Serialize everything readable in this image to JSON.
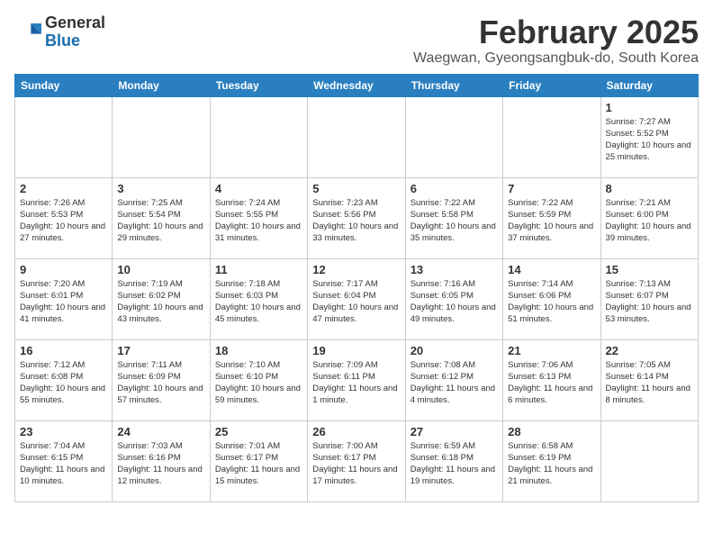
{
  "header": {
    "logo_general": "General",
    "logo_blue": "Blue",
    "month_year": "February 2025",
    "location": "Waegwan, Gyeongsangbuk-do, South Korea"
  },
  "weekdays": [
    "Sunday",
    "Monday",
    "Tuesday",
    "Wednesday",
    "Thursday",
    "Friday",
    "Saturday"
  ],
  "weeks": [
    [
      {
        "day": "",
        "info": ""
      },
      {
        "day": "",
        "info": ""
      },
      {
        "day": "",
        "info": ""
      },
      {
        "day": "",
        "info": ""
      },
      {
        "day": "",
        "info": ""
      },
      {
        "day": "",
        "info": ""
      },
      {
        "day": "1",
        "info": "Sunrise: 7:27 AM\nSunset: 5:52 PM\nDaylight: 10 hours and 25 minutes."
      }
    ],
    [
      {
        "day": "2",
        "info": "Sunrise: 7:26 AM\nSunset: 5:53 PM\nDaylight: 10 hours and 27 minutes."
      },
      {
        "day": "3",
        "info": "Sunrise: 7:25 AM\nSunset: 5:54 PM\nDaylight: 10 hours and 29 minutes."
      },
      {
        "day": "4",
        "info": "Sunrise: 7:24 AM\nSunset: 5:55 PM\nDaylight: 10 hours and 31 minutes."
      },
      {
        "day": "5",
        "info": "Sunrise: 7:23 AM\nSunset: 5:56 PM\nDaylight: 10 hours and 33 minutes."
      },
      {
        "day": "6",
        "info": "Sunrise: 7:22 AM\nSunset: 5:58 PM\nDaylight: 10 hours and 35 minutes."
      },
      {
        "day": "7",
        "info": "Sunrise: 7:22 AM\nSunset: 5:59 PM\nDaylight: 10 hours and 37 minutes."
      },
      {
        "day": "8",
        "info": "Sunrise: 7:21 AM\nSunset: 6:00 PM\nDaylight: 10 hours and 39 minutes."
      }
    ],
    [
      {
        "day": "9",
        "info": "Sunrise: 7:20 AM\nSunset: 6:01 PM\nDaylight: 10 hours and 41 minutes."
      },
      {
        "day": "10",
        "info": "Sunrise: 7:19 AM\nSunset: 6:02 PM\nDaylight: 10 hours and 43 minutes."
      },
      {
        "day": "11",
        "info": "Sunrise: 7:18 AM\nSunset: 6:03 PM\nDaylight: 10 hours and 45 minutes."
      },
      {
        "day": "12",
        "info": "Sunrise: 7:17 AM\nSunset: 6:04 PM\nDaylight: 10 hours and 47 minutes."
      },
      {
        "day": "13",
        "info": "Sunrise: 7:16 AM\nSunset: 6:05 PM\nDaylight: 10 hours and 49 minutes."
      },
      {
        "day": "14",
        "info": "Sunrise: 7:14 AM\nSunset: 6:06 PM\nDaylight: 10 hours and 51 minutes."
      },
      {
        "day": "15",
        "info": "Sunrise: 7:13 AM\nSunset: 6:07 PM\nDaylight: 10 hours and 53 minutes."
      }
    ],
    [
      {
        "day": "16",
        "info": "Sunrise: 7:12 AM\nSunset: 6:08 PM\nDaylight: 10 hours and 55 minutes."
      },
      {
        "day": "17",
        "info": "Sunrise: 7:11 AM\nSunset: 6:09 PM\nDaylight: 10 hours and 57 minutes."
      },
      {
        "day": "18",
        "info": "Sunrise: 7:10 AM\nSunset: 6:10 PM\nDaylight: 10 hours and 59 minutes."
      },
      {
        "day": "19",
        "info": "Sunrise: 7:09 AM\nSunset: 6:11 PM\nDaylight: 11 hours and 1 minute."
      },
      {
        "day": "20",
        "info": "Sunrise: 7:08 AM\nSunset: 6:12 PM\nDaylight: 11 hours and 4 minutes."
      },
      {
        "day": "21",
        "info": "Sunrise: 7:06 AM\nSunset: 6:13 PM\nDaylight: 11 hours and 6 minutes."
      },
      {
        "day": "22",
        "info": "Sunrise: 7:05 AM\nSunset: 6:14 PM\nDaylight: 11 hours and 8 minutes."
      }
    ],
    [
      {
        "day": "23",
        "info": "Sunrise: 7:04 AM\nSunset: 6:15 PM\nDaylight: 11 hours and 10 minutes."
      },
      {
        "day": "24",
        "info": "Sunrise: 7:03 AM\nSunset: 6:16 PM\nDaylight: 11 hours and 12 minutes."
      },
      {
        "day": "25",
        "info": "Sunrise: 7:01 AM\nSunset: 6:17 PM\nDaylight: 11 hours and 15 minutes."
      },
      {
        "day": "26",
        "info": "Sunrise: 7:00 AM\nSunset: 6:17 PM\nDaylight: 11 hours and 17 minutes."
      },
      {
        "day": "27",
        "info": "Sunrise: 6:59 AM\nSunset: 6:18 PM\nDaylight: 11 hours and 19 minutes."
      },
      {
        "day": "28",
        "info": "Sunrise: 6:58 AM\nSunset: 6:19 PM\nDaylight: 11 hours and 21 minutes."
      },
      {
        "day": "",
        "info": ""
      }
    ]
  ]
}
